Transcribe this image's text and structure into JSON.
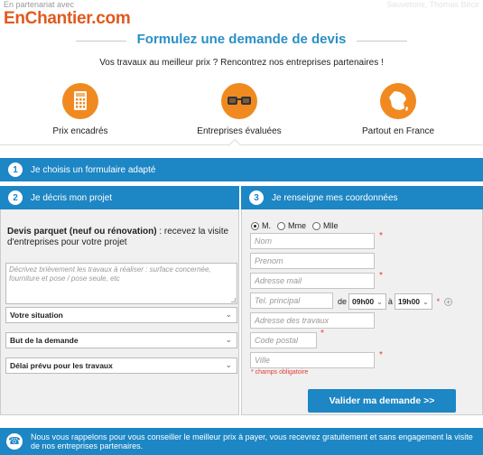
{
  "header": {
    "partner_label": "En partenariat avec",
    "corner_label": "Sauvetons, Thomas Bécir",
    "logo": "EnChantier.com"
  },
  "hero": {
    "title": "Formulez une demande de devis",
    "subtitle": "Vos travaux au meilleur prix ? Rencontrez nos entreprises partenaires !"
  },
  "features": [
    {
      "label": "Prix encadrés",
      "icon": "calculator-icon"
    },
    {
      "label": "Entreprises évaluées",
      "icon": "glasses-icon"
    },
    {
      "label": "Partout en France",
      "icon": "france-map-icon"
    }
  ],
  "steps": [
    {
      "num": "1",
      "label": "Je choisis un formulaire adapté"
    },
    {
      "num": "2",
      "label": "Je décris mon projet"
    },
    {
      "num": "3",
      "label": "Je renseigne mes coordonnées"
    }
  ],
  "project": {
    "title": "Devis parquet (neuf ou rénovation)",
    "title_suffix": " : recevez la visite d'entreprises pour votre projet",
    "textarea_placeholder": "Décrivez brièvement les travaux à réaliser : surface concernée, fourniture et pose / pose seule, etc",
    "selects": [
      "Votre situation",
      "But de la demande",
      "Délai prévu pour les travaux"
    ]
  },
  "contact": {
    "civility": [
      "M.",
      "Mme",
      "Mlle"
    ],
    "selected_civility": "M.",
    "placeholders": {
      "nom": "Nom",
      "prenom": "Prenom",
      "adresse": "Adresse mail",
      "tel": "Tel. principal",
      "travaux": "Adresse des travaux",
      "cp": "Code postal",
      "ville": "Ville"
    },
    "tel_from_label": "de",
    "tel_from": "09h00",
    "tel_to_label": "à",
    "tel_to": "19h00",
    "required_mark": "*",
    "mandatory_note": "* champs obligatoire",
    "submit_label": "Valider ma demande >>"
  },
  "footer": {
    "text": "Nous vous rappelons pour vous conseiller le meilleur prix à payer, vous recevrez gratuitement et sans engagement la visite de nos entreprises partenaires."
  },
  "colors": {
    "accent": "#1d86c4",
    "title": "#2b8fc6",
    "orange": "#f08a20",
    "required": "#e53935",
    "logo": "#e2591e"
  }
}
